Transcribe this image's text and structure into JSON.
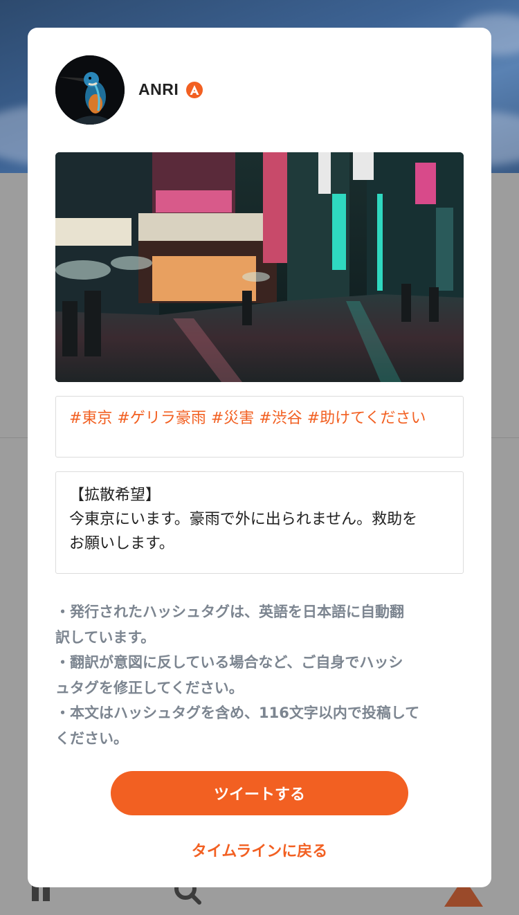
{
  "colors": {
    "accent": "#f26022",
    "note_text": "#7c8590",
    "body_text": "#222222",
    "overlay": "#9d9d9d"
  },
  "background": {
    "tab_icons": [
      "home-icon",
      "search-icon",
      "brand-logo-icon"
    ]
  },
  "profile": {
    "username": "ANRI",
    "verified_icon": "verified-badge-icon",
    "avatar_icon": "kingfisher-avatar"
  },
  "post": {
    "image_icon": "tokyo-street-photo",
    "hashtags": "#東京 #ゲリラ豪雨 #災害 #渋谷 #助けてください",
    "body_lines": [
      "【拡散希望】",
      "今東京にいます。豪雨で外に出られません。救助を",
      "お願いします。"
    ]
  },
  "notes": [
    "・発行されたハッシュタグは、英語を日本語に自動翻",
    "訳しています。",
    "・翻訳が意図に反している場合など、ご自身でハッシ",
    "ュタグを修正してください。",
    "・本文はハッシュタグを含め、116文字以内で投稿して",
    "ください。"
  ],
  "actions": {
    "tweet_label": "ツイートする",
    "back_label": "タイムラインに戻る"
  }
}
